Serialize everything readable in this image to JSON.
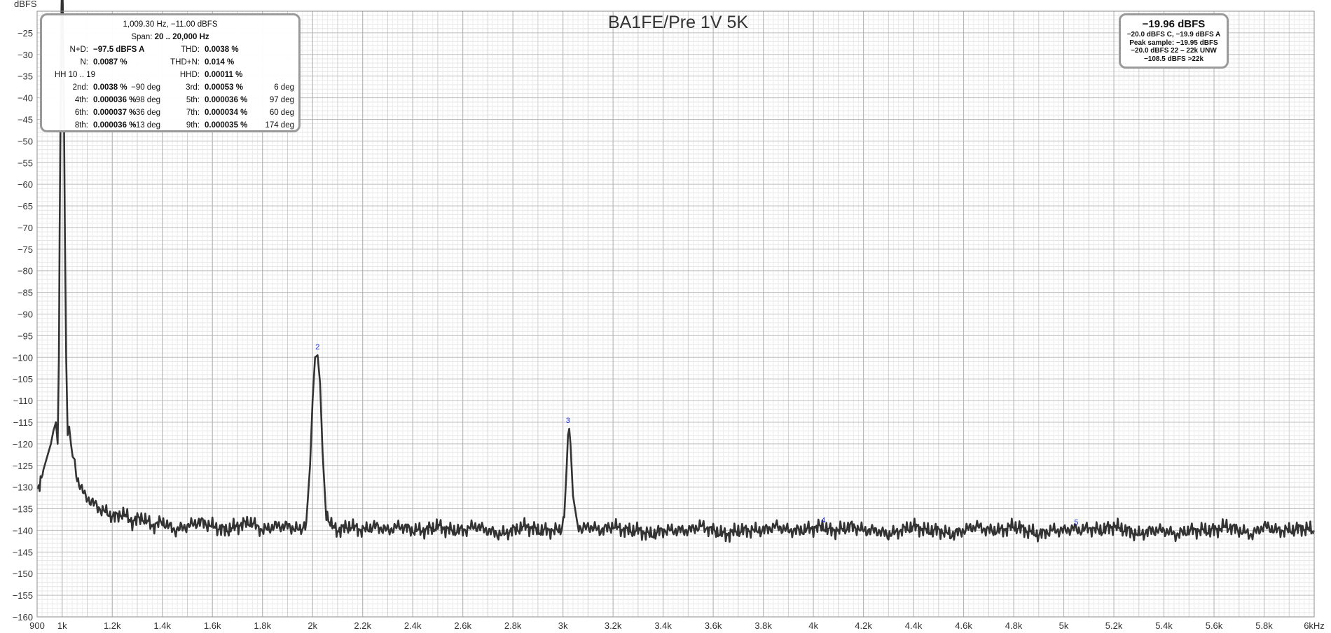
{
  "chart_data": {
    "type": "line",
    "title": "BA1FE/Pre 1V 5K",
    "ylabel": "dBFS",
    "xunit": "kHz",
    "xlim": [
      900,
      6000
    ],
    "ylim": [
      -160,
      -20
    ],
    "grid": true,
    "x_ticks": [
      {
        "v": 900,
        "l": "900"
      },
      {
        "v": 1000,
        "l": "1k"
      },
      {
        "v": 1200,
        "l": "1.2k"
      },
      {
        "v": 1400,
        "l": "1.4k"
      },
      {
        "v": 1600,
        "l": "1.6k"
      },
      {
        "v": 1800,
        "l": "1.8k"
      },
      {
        "v": 2000,
        "l": "2k"
      },
      {
        "v": 2200,
        "l": "2.2k"
      },
      {
        "v": 2400,
        "l": "2.4k"
      },
      {
        "v": 2600,
        "l": "2.6k"
      },
      {
        "v": 2800,
        "l": "2.8k"
      },
      {
        "v": 3000,
        "l": "3k"
      },
      {
        "v": 3200,
        "l": "3.2k"
      },
      {
        "v": 3400,
        "l": "3.4k"
      },
      {
        "v": 3600,
        "l": "3.6k"
      },
      {
        "v": 3800,
        "l": "3.8k"
      },
      {
        "v": 4000,
        "l": "4k"
      },
      {
        "v": 4200,
        "l": "4.2k"
      },
      {
        "v": 4400,
        "l": "4.4k"
      },
      {
        "v": 4600,
        "l": "4.6k"
      },
      {
        "v": 4800,
        "l": "4.8k"
      },
      {
        "v": 5000,
        "l": "5k"
      },
      {
        "v": 5200,
        "l": "5.2k"
      },
      {
        "v": 5400,
        "l": "5.4k"
      },
      {
        "v": 5600,
        "l": "5.6k"
      },
      {
        "v": 5800,
        "l": "5.8k"
      },
      {
        "v": 6000,
        "l": "6k"
      }
    ],
    "y_ticks": [
      -25,
      -30,
      -35,
      -40,
      -45,
      -50,
      -55,
      -60,
      -65,
      -70,
      -75,
      -80,
      -85,
      -90,
      -95,
      -100,
      -105,
      -110,
      -115,
      -120,
      -125,
      -130,
      -135,
      -140,
      -145,
      -150,
      -155,
      -160
    ],
    "series": [
      {
        "color": "#333333",
        "x": [
          900,
          910,
          925,
          940,
          955,
          965,
          975,
          982,
          987,
          990,
          994,
          997,
          1000,
          1003,
          1007,
          1011,
          1016,
          1022,
          1028,
          1035,
          1042,
          1050,
          1060,
          1075,
          1090,
          1110,
          1130,
          1150,
          1180,
          1210,
          1240,
          1280,
          1320,
          1360,
          1400,
          1450,
          1500,
          1550,
          1600,
          1650,
          1700,
          1750,
          1800,
          1850,
          1900,
          1950,
          1975,
          1990,
          2000,
          2010,
          2020,
          2030,
          2040,
          2055,
          2075,
          2100,
          2150,
          2200,
          2250,
          2300,
          2350,
          2400,
          2450,
          2500,
          2550,
          2600,
          2650,
          2700,
          2750,
          2800,
          2850,
          2900,
          2950,
          2990,
          3005,
          3015,
          3020,
          3025,
          3030,
          3040,
          3055,
          3075,
          3100,
          3150,
          3200,
          3250,
          3300,
          3350,
          3400,
          3450,
          3500,
          3550,
          3600,
          3650,
          3700,
          3750,
          3800,
          3850,
          3900,
          3950,
          4000,
          4040,
          4060,
          4100,
          4150,
          4200,
          4250,
          4300,
          4350,
          4400,
          4450,
          4500,
          4550,
          4600,
          4650,
          4700,
          4750,
          4800,
          4850,
          4900,
          4950,
          5000,
          5040,
          5060,
          5100,
          5150,
          5200,
          5250,
          5300,
          5350,
          5400,
          5450,
          5500,
          5550,
          5600,
          5650,
          5700,
          5750,
          5800,
          5850,
          5900,
          5950,
          6000
        ],
        "y": [
          -131,
          -130,
          -126,
          -123,
          -120,
          -117,
          -115,
          -120,
          -100,
          -70,
          -40,
          -20,
          -12,
          -20,
          -42,
          -72,
          -100,
          -118,
          -116,
          -120,
          -123,
          -125,
          -128,
          -130,
          -132,
          -133,
          -134,
          -135,
          -136,
          -137,
          -136,
          -138,
          -137,
          -139,
          -138,
          -140,
          -139,
          -138,
          -139,
          -140,
          -139,
          -138,
          -140,
          -139,
          -139,
          -140,
          -138,
          -125,
          -110,
          -100,
          -99.5,
          -106,
          -122,
          -136,
          -139,
          -140,
          -139,
          -140,
          -139,
          -140,
          -139,
          -140,
          -140,
          -139,
          -140,
          -140,
          -139,
          -140,
          -141,
          -140,
          -139,
          -140,
          -140,
          -140,
          -137,
          -125,
          -118,
          -116.5,
          -120,
          -132,
          -138,
          -140,
          -139,
          -140,
          -139,
          -140,
          -140,
          -141,
          -140,
          -140,
          -140,
          -139,
          -140,
          -141,
          -140,
          -140,
          -140,
          -139,
          -140,
          -140,
          -139.5,
          -139,
          -140,
          -140,
          -139,
          -140,
          -140,
          -141,
          -140,
          -139,
          -140,
          -140,
          -141,
          -140,
          -139,
          -140,
          -140,
          -139,
          -140,
          -141,
          -140,
          -140,
          -139.5,
          -140,
          -139.5,
          -140,
          -139,
          -140,
          -141,
          -140,
          -140,
          -141,
          -140,
          -140,
          -140,
          -139,
          -140,
          -141,
          -139,
          -140,
          -140,
          -139.5,
          -140
        ]
      }
    ],
    "harmonic_markers": [
      {
        "label": "2",
        "x": 2020,
        "y": -99.5
      },
      {
        "label": "3",
        "x": 3020,
        "y": -116.5
      },
      {
        "label": "4",
        "x": 4040,
        "y": -139.5
      },
      {
        "label": "5",
        "x": 5050,
        "y": -140
      }
    ],
    "marker_color": "#1a2ad8"
  },
  "distortion_box": {
    "header_freq": "1,009.30 Hz, −11.00 dBFS",
    "span_label": "Span:",
    "span_value": "20 .. 20,000 Hz",
    "nd_label": "N+D:",
    "nd_value": "−97.5 dBFS A",
    "thd_label": "THD:",
    "thd_value": "0.0038 %",
    "n_label": "N:",
    "n_value": "0.0087 %",
    "thdn_label": "THD+N:",
    "thdn_value": "0.014 %",
    "hh_label": "HH 10 .. 19",
    "hhd_label": "HHD:",
    "hhd_value": "0.00011 %",
    "harmonics": [
      {
        "a_label": "2nd:",
        "a_value": "0.0038 %",
        "a_phase": "−90 deg",
        "b_label": "3rd:",
        "b_value": "0.00053 %",
        "b_phase": "6 deg"
      },
      {
        "a_label": "4th:",
        "a_value": "0.000036 %",
        "a_phase": "98 deg",
        "b_label": "5th:",
        "b_value": "0.000036 %",
        "b_phase": "97 deg"
      },
      {
        "a_label": "6th:",
        "a_value": "0.000037 %",
        "a_phase": "36 deg",
        "b_label": "7th:",
        "b_value": "0.000034 %",
        "b_phase": "60 deg"
      },
      {
        "a_label": "8th:",
        "a_value": "0.000036 %",
        "a_phase": "−13 deg",
        "b_label": "9th:",
        "b_value": "0.000035 %",
        "b_phase": "174 deg"
      }
    ]
  },
  "level_box": {
    "main": "−19.96 dBFS",
    "line1": "−20.0 dBFS C, −19.9 dBFS A",
    "line2": "Peak sample: −19.95 dBFS",
    "line3": "−20.0 dBFS 22 – 22k UNW",
    "line4": "−108.5 dBFS >22k"
  }
}
